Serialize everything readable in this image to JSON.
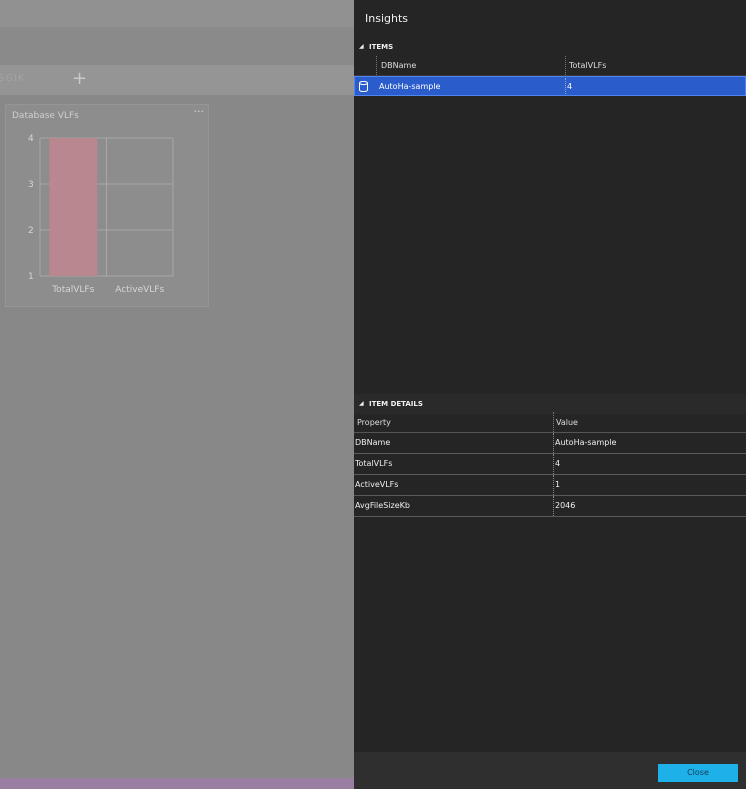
{
  "dashboard": {
    "tab_label": "SGIK",
    "add_tab_icon": "plus-icon",
    "widget": {
      "title": "Database VLFs",
      "more_label": "···"
    }
  },
  "chart_data": {
    "type": "bar",
    "title": "Database VLFs",
    "categories": [
      "TotalVLFs",
      "ActiveVLFs"
    ],
    "values": [
      4,
      1
    ],
    "ylim": [
      1,
      4
    ],
    "yticks": [
      "1",
      "2",
      "3",
      "4"
    ],
    "bar_color": "#b9878f",
    "grid": true
  },
  "insights": {
    "title": "Insights",
    "items": {
      "header": "ITEMS",
      "columns": [
        "DBName",
        "TotalVLFs"
      ],
      "rows": [
        {
          "icon": "database-icon",
          "DBName": "AutoHa-sample",
          "TotalVLFs": "4"
        }
      ]
    },
    "details": {
      "header": "ITEM DETAILS",
      "columns": [
        "Property",
        "Value"
      ],
      "rows": [
        {
          "property": "DBName",
          "value": "AutoHa-sample"
        },
        {
          "property": "TotalVLFs",
          "value": "4"
        },
        {
          "property": "ActiveVLFs",
          "value": "1"
        },
        {
          "property": "AvgFileSizeKb",
          "value": "2046"
        }
      ]
    },
    "close_label": "Close"
  },
  "colors": {
    "selection": "#2b5ccc",
    "accent_button": "#1eb0e8",
    "panel_bg": "#252525"
  }
}
